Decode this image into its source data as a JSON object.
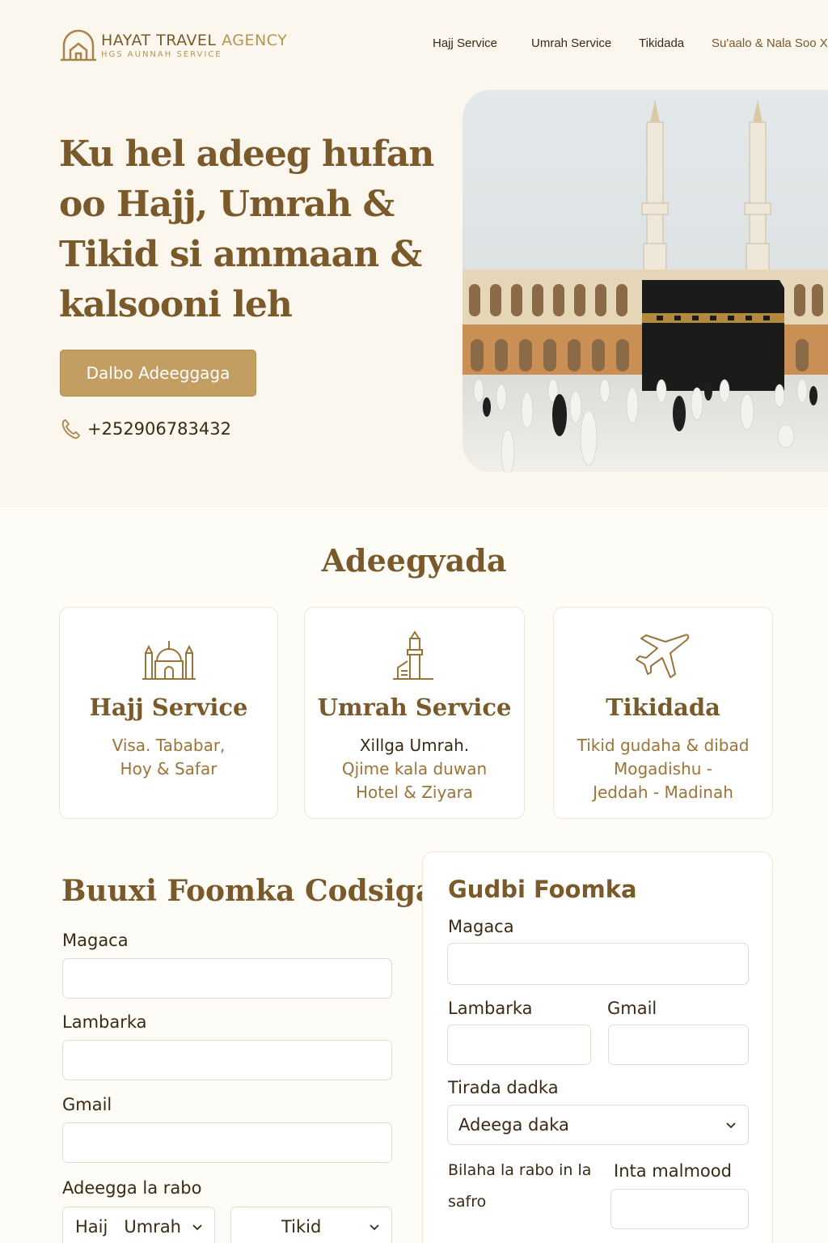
{
  "brand": {
    "name_main": "HAYAT TRAVEL",
    "name_accent": "AGENCY",
    "tagline": "HGS AUNNAH SERVICE",
    "icon": "house-arch-logo-icon",
    "color_primary": "#7a5a2a",
    "color_accent": "#c29e63"
  },
  "nav": {
    "items": [
      "Hajj Service",
      "Umrah Service",
      "Tikidada",
      "Su'aalo & Nala Soo X"
    ]
  },
  "hero": {
    "title": "Ku hel adeeg hufan oo Hajj, Umrah & Tikid si ammaan & kalsooni leh",
    "cta_label": "Dalbo Adeeggaga",
    "phone_icon": "phone-icon",
    "phone": "+252906783432",
    "image_icon": "kaaba-mecca-photo"
  },
  "services": {
    "title": "Adeegyada",
    "cards": [
      {
        "icon": "mosque-icon",
        "title": "Hajj Service",
        "lines": [
          "Visa. Tababar,",
          "Hoy & Safar"
        ]
      },
      {
        "icon": "minaret-icon",
        "title": "Umrah Service",
        "highlight": "Xillga Umrah.",
        "lines": [
          "Qjime kala duwan",
          "Hotel & Ziyara"
        ]
      },
      {
        "icon": "airplane-icon",
        "title": "Tikidada",
        "lines": [
          "Tikid gudaha & dibad",
          "Mogadishu -",
          "Jeddah - Madinah"
        ]
      }
    ]
  },
  "request_form": {
    "title": "Buuxi Foomka Codsiga",
    "name_label": "Magaca",
    "phone_label": "Lambarka",
    "email_label": "Gmail",
    "service_label": "Adeegga la rabo",
    "service_select_1": "Haij   Umrah",
    "service_select_2": "Tikid"
  },
  "submit_form": {
    "title": "Gudbi Foomka",
    "name_label": "Magaca",
    "phone_label": "Lambarka",
    "email_label": "Gmail",
    "type_label": "Tirada dadka",
    "type_select": "Adeega daka",
    "month_label_1": "Bilaha la rabo in la",
    "month_label_2": "safro",
    "passport_label": "Inta malmood"
  }
}
